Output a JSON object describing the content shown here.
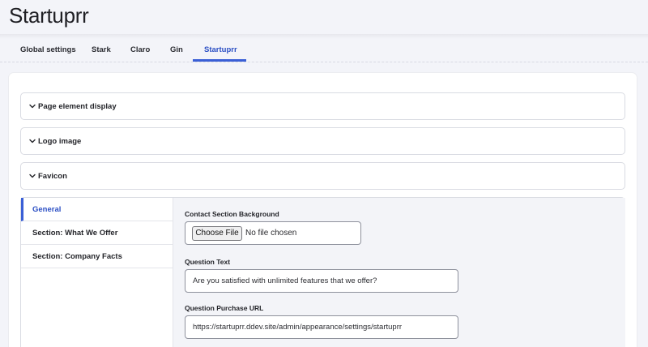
{
  "page": {
    "title": "Startuprr"
  },
  "tabs": [
    {
      "label": "Global settings"
    },
    {
      "label": "Stark"
    },
    {
      "label": "Claro"
    },
    {
      "label": "Gin"
    },
    {
      "label": "Startuprr",
      "active": true
    }
  ],
  "details": [
    {
      "label": "Page element display",
      "icon": "chevron-down-icon"
    },
    {
      "label": "Logo image",
      "icon": "chevron-down-icon"
    },
    {
      "label": "Favicon",
      "icon": "chevron-down-icon"
    }
  ],
  "vertical_tabs": [
    {
      "label": "General",
      "active": true
    },
    {
      "label": "Section: What We Offer"
    },
    {
      "label": "Section: Company Facts"
    }
  ],
  "form": {
    "contact_bg": {
      "label": "Contact Section Background",
      "button": "Choose File",
      "status": "No file chosen"
    },
    "question_text": {
      "label": "Question Text",
      "value": "Are you satisfied with unlimited features that we offer?"
    },
    "question_url": {
      "label": "Question Purchase URL",
      "value": "https://startuprr.ddev.site/admin/appearance/settings/startuprr"
    }
  },
  "colors": {
    "accent": "#3a5fd6",
    "background": "#f3f4f9",
    "border": "#d9dbe2"
  }
}
